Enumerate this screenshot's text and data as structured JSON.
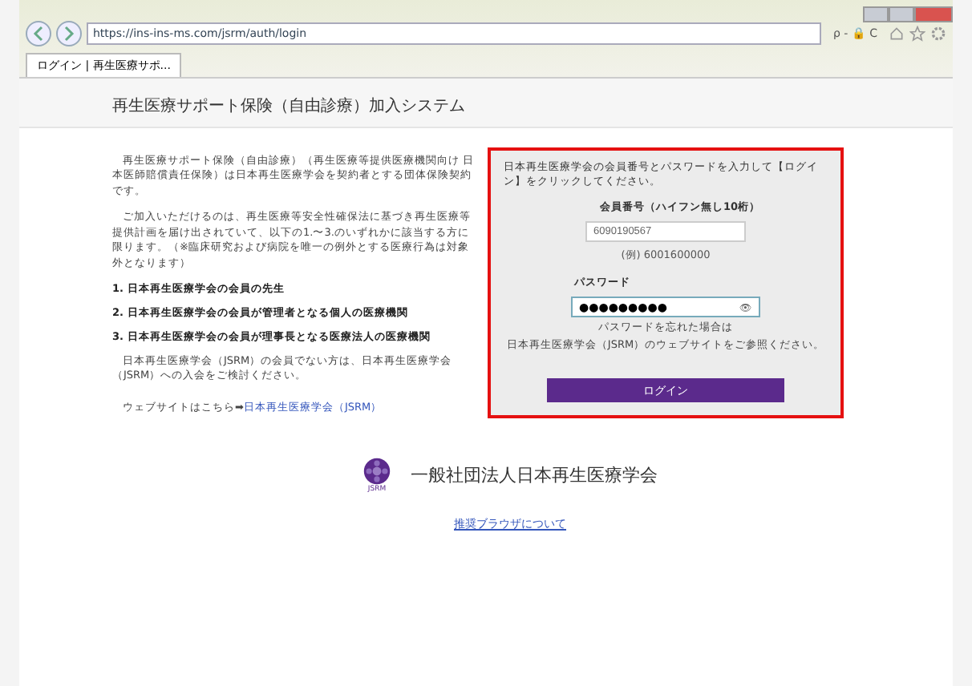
{
  "browser": {
    "url": "https://ins-ins-ms.com/jsrm/auth/login",
    "tab": {
      "label": "ログイン | 再生医療サポ...",
      "selected": true
    },
    "tools": [
      "ρ - 🔒 C"
    ]
  },
  "header": {
    "title": "再生医療サポート保険（自由診療）加入システム"
  },
  "intro": {
    "paragraphs": [
      "再生医療サポート保険（自由診療）（再生医療等提供医療機関向け 日本医師賠償責任保険）は日本再生医療学会を契約者とする団体保険契約です。",
      "ご加入いただけるのは、再生医療等安全性確保法に基づき再生医療等提供計画を届け出されていて、以下の1.〜3.のいずれかに該当する方に限ります。（※臨床研究および病院を唯一の例外とする医療行為は対象外となります）"
    ],
    "eligibility": [
      "1. 日本再生医療学会の会員の先生",
      "2. 日本再生医療学会の会員が管理者となる個人の医療機関",
      "3. 日本再生医療学会の会員が理事長となる医療法人の医療機関"
    ],
    "note": "日本再生医療学会（JSRM）の会員でない方は、日本再生医療学会（JSRM）への入会をご検討ください。",
    "website_label": "ウェブサイトはこちら➡",
    "website_link": "日本再生医療学会（JSRM）"
  },
  "login": {
    "instruction": "日本再生医療学会の会員番号とパスワードを入力して【ログイン】をクリックしてください。",
    "member_label": "会員番号（ハイフン無し10桁）",
    "member_value": "6090190567",
    "member_example": "(例) 6001600000",
    "password_label": "パスワード",
    "password_value": "●●●●●●●●●",
    "reveal": "👁",
    "forgot": [
      "パスワードを忘れた場合は",
      "日本再生医療学会（JSRM）のウェブサイトをご参照ください。"
    ],
    "button": "ログイン"
  },
  "footer": {
    "org": "一般社団法人日本再生医療学会",
    "logo_text": "JSRM",
    "link": "推奨ブラウザについて"
  }
}
